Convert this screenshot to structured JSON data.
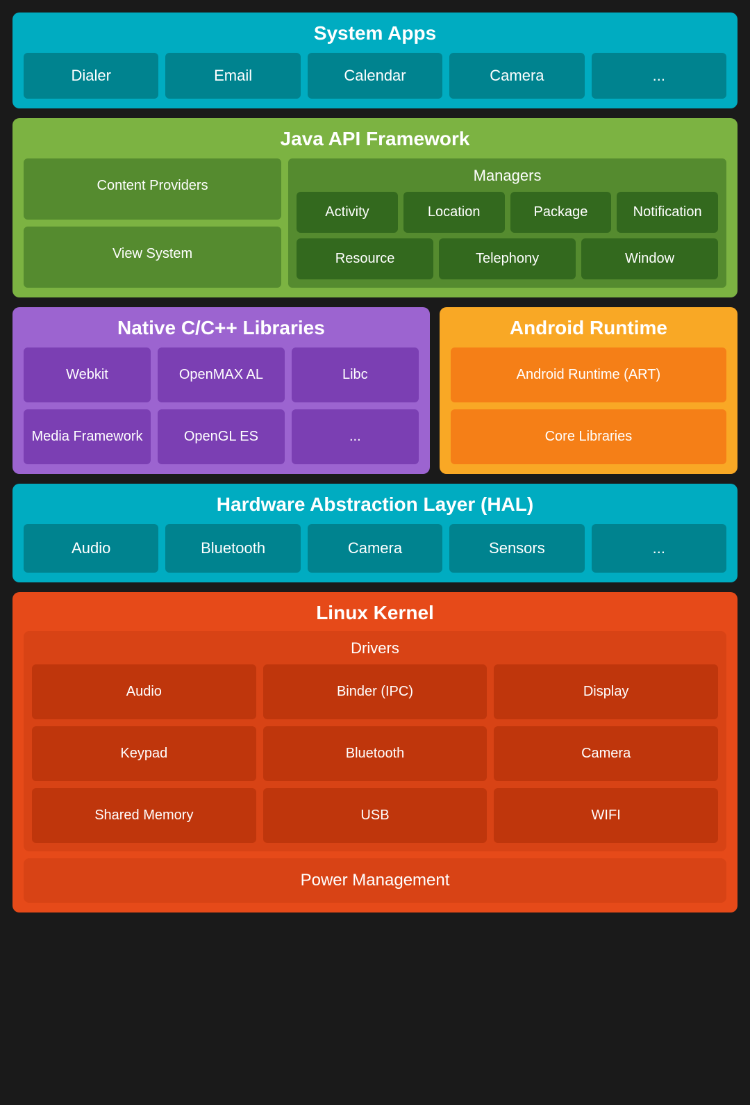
{
  "system_apps": {
    "title": "System Apps",
    "items": [
      "Dialer",
      "Email",
      "Calendar",
      "Camera",
      "..."
    ]
  },
  "java_api": {
    "title": "Java API Framework",
    "left": [
      "Content Providers",
      "View System"
    ],
    "managers": {
      "title": "Managers",
      "row1": [
        "Activity",
        "Location",
        "Package",
        "Notification"
      ],
      "row2": [
        "Resource",
        "Telephony",
        "Window"
      ]
    }
  },
  "native_libs": {
    "title": "Native C/C++ Libraries",
    "items": [
      "Webkit",
      "OpenMAX AL",
      "Libc",
      "Media Framework",
      "OpenGL ES",
      "..."
    ]
  },
  "android_runtime": {
    "title": "Android Runtime",
    "items": [
      "Android Runtime (ART)",
      "Core Libraries"
    ]
  },
  "hal": {
    "title": "Hardware Abstraction Layer (HAL)",
    "items": [
      "Audio",
      "Bluetooth",
      "Camera",
      "Sensors",
      "..."
    ]
  },
  "linux_kernel": {
    "title": "Linux Kernel",
    "drivers": {
      "title": "Drivers",
      "items": [
        "Audio",
        "Binder (IPC)",
        "Display",
        "Keypad",
        "Bluetooth",
        "Camera",
        "Shared Memory",
        "USB",
        "WIFI"
      ]
    },
    "power_management": "Power Management"
  }
}
